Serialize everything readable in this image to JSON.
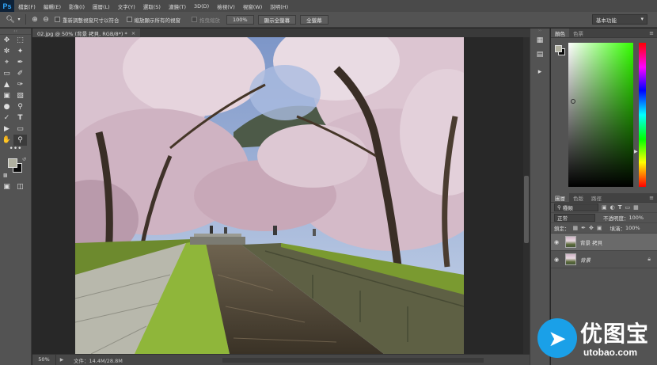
{
  "app": {
    "logo": "Ps"
  },
  "menu": [
    "檔案(F)",
    "編輯(E)",
    "影像(I)",
    "圖層(L)",
    "文字(Y)",
    "選取(S)",
    "濾鏡(T)",
    "3D(D)",
    "檢視(V)",
    "視窗(W)",
    "說明(H)"
  ],
  "options": {
    "resize_windows": "重新調整視窗尺寸以符合",
    "zoom_all": "縮放顯示所有的視窗",
    "scrubby_zoom": "拖曳縮放",
    "zoom_100": "100%",
    "fit_screen": "顯示全螢幕",
    "fill_screen": "全螢幕",
    "workspace": "基本功能"
  },
  "document": {
    "tab_title": "02.jpg @ 50% (背景 拷貝, RGB/8*) *",
    "close": "×"
  },
  "status": {
    "zoom": "50%",
    "doc_size": "文件：14.4M/28.8M"
  },
  "color_panel": {
    "tabs": [
      "顏色",
      "色票"
    ],
    "colors": {
      "foreground": "#b0b0a0",
      "background": "#0a0a0a"
    }
  },
  "layers_panel": {
    "tabs": [
      "圖層",
      "色版",
      "路徑"
    ],
    "kind_filter": "種類",
    "blend_mode": "正常",
    "opacity_label": "不透明度：",
    "opacity_value": "100%",
    "lock_label": "鎖定：",
    "fill_label": "填滿：",
    "fill_value": "100%",
    "layers": [
      {
        "name": "背景 拷貝",
        "selected": true,
        "italic": false
      },
      {
        "name": "背景",
        "selected": false,
        "italic": true
      }
    ]
  },
  "watermark": {
    "brand": "优图宝",
    "url": "utobao.com"
  }
}
